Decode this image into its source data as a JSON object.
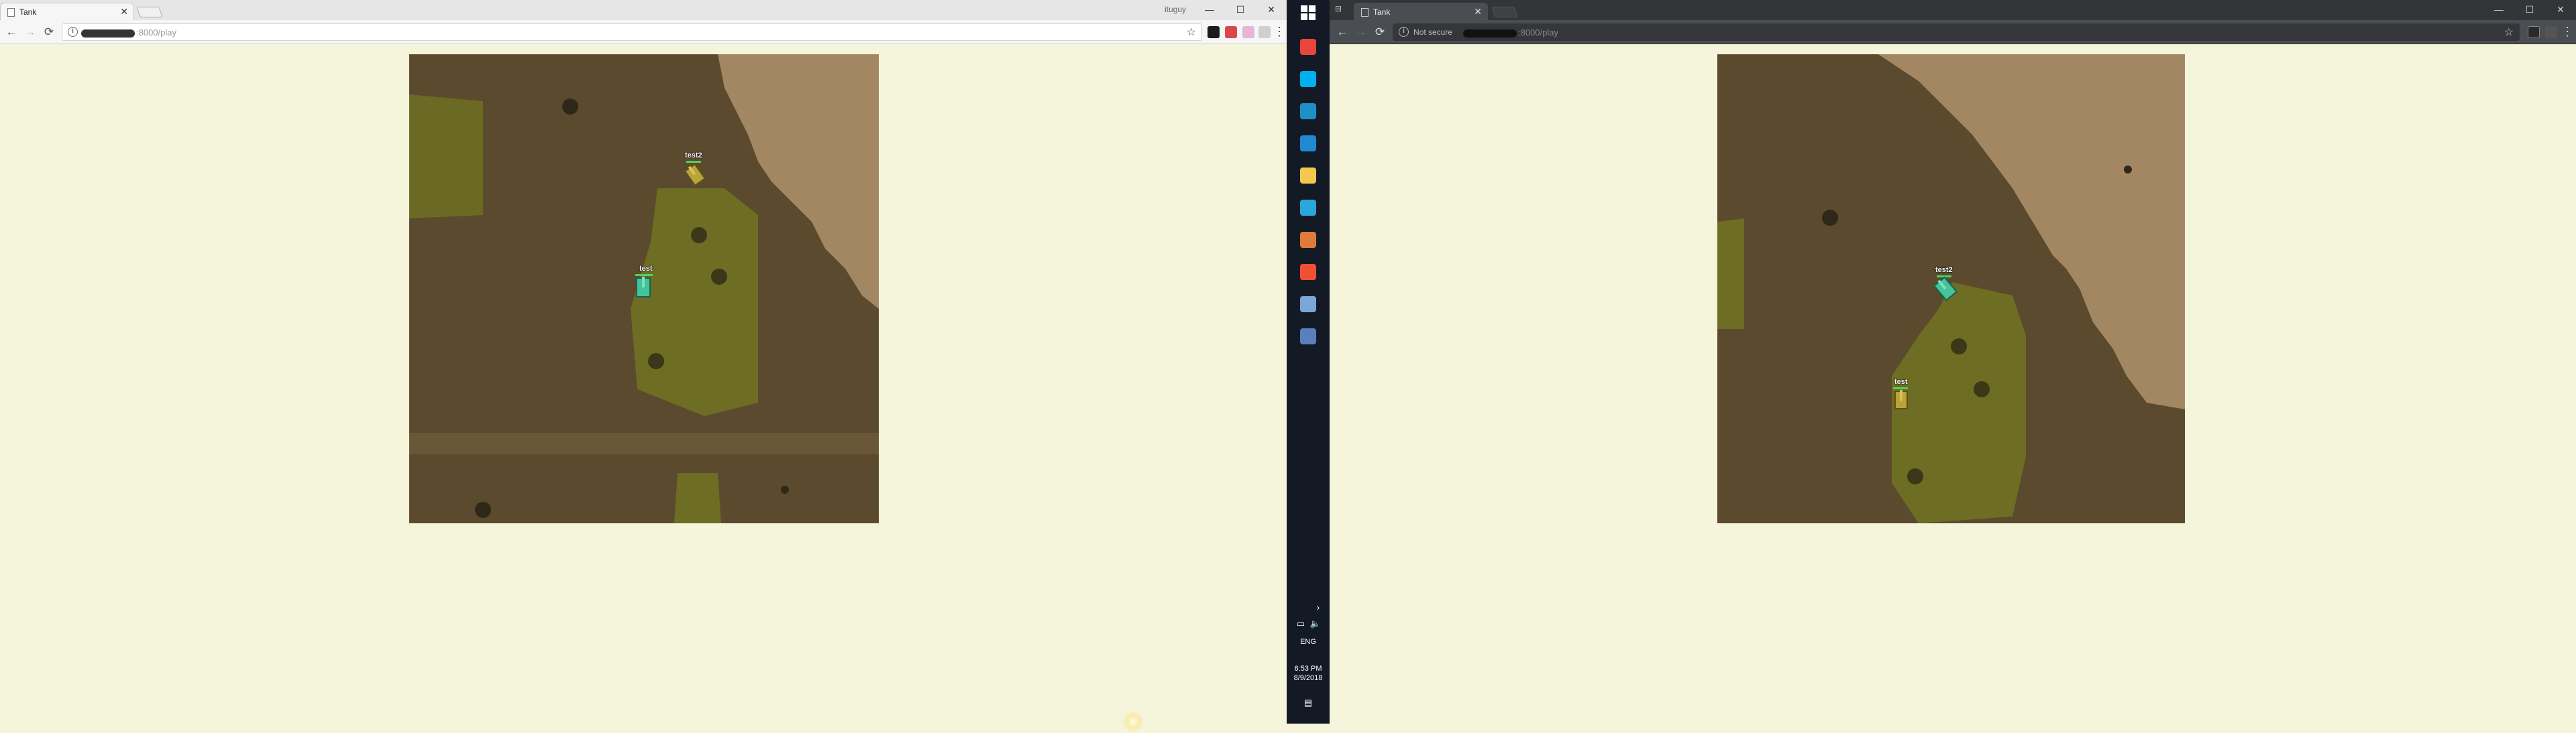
{
  "left_window": {
    "tab": {
      "title": "Tank"
    },
    "profile_badge": "ituguy",
    "address": {
      "url_suffix": ":8000/play"
    }
  },
  "right_window": {
    "tab": {
      "title": "Tank"
    },
    "address": {
      "security_text": "Not secure",
      "url_suffix": ":8000/play"
    }
  },
  "window_controls": {
    "minimize": "—",
    "maximize": "☐",
    "close": "✕"
  },
  "nav": {
    "back": "←",
    "forward": "→",
    "reload": "⟳"
  },
  "game_left": {
    "tanks": [
      {
        "name": "test2",
        "color": "olive"
      },
      {
        "name": "test",
        "color": "teal"
      }
    ]
  },
  "game_right": {
    "tanks": [
      {
        "name": "test2",
        "color": "teal"
      },
      {
        "name": "test",
        "color": "olive"
      }
    ]
  },
  "taskbar": {
    "language": "ENG",
    "time": "6:53 PM",
    "date": "8/9/2018",
    "chevron": "›",
    "apps": [
      {
        "name": "chrome",
        "color": "#e8453c"
      },
      {
        "name": "skype",
        "color": "#00aff0"
      },
      {
        "name": "store",
        "color": "#1e90c8"
      },
      {
        "name": "vscode",
        "color": "#1f8ad2"
      },
      {
        "name": "file-explorer",
        "color": "#f2c94c"
      },
      {
        "name": "browser-blue",
        "color": "#2aa6d8"
      },
      {
        "name": "media-player",
        "color": "#e07b39"
      },
      {
        "name": "git-client",
        "color": "#f05033"
      },
      {
        "name": "photos",
        "color": "#7aa7d6"
      },
      {
        "name": "calculator",
        "color": "#5b7fbd"
      }
    ]
  }
}
